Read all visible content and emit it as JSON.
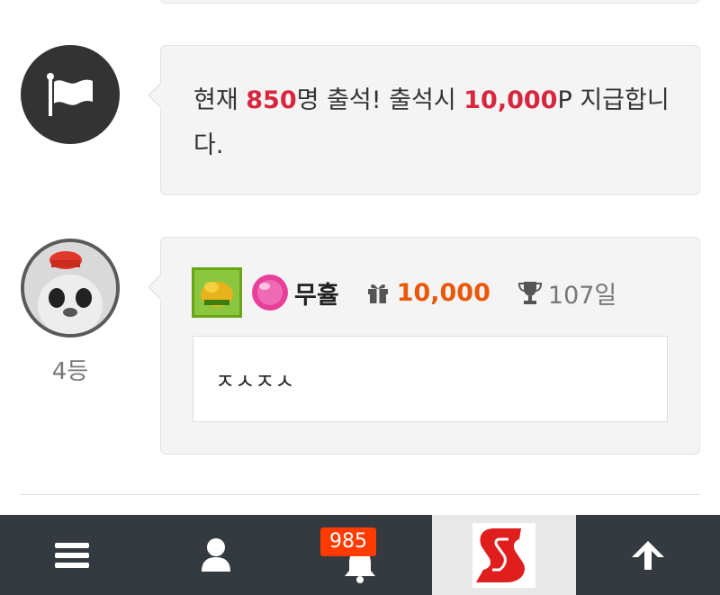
{
  "notice": {
    "prefix": "현재 ",
    "count": "850",
    "mid": "명 출석! 출석시 ",
    "reward": "10,000",
    "suffix": "P 지급합니다."
  },
  "entry": {
    "rank_label": "4등",
    "username": "무휼",
    "points": "10,000",
    "days": "107일",
    "comment": "ㅈㅅㅈㅅ"
  },
  "nav": {
    "items": [
      "menu-icon",
      "user-icon",
      "bell-icon",
      "site-logo",
      "arrow-up-icon"
    ],
    "notification_count": "985"
  },
  "colors": {
    "highlight_red": "#d7263d",
    "points_orange": "#e8590c",
    "nav_bg": "#343a40",
    "badge_bg": "#ff3b00",
    "logo_red": "#e01e1e"
  }
}
